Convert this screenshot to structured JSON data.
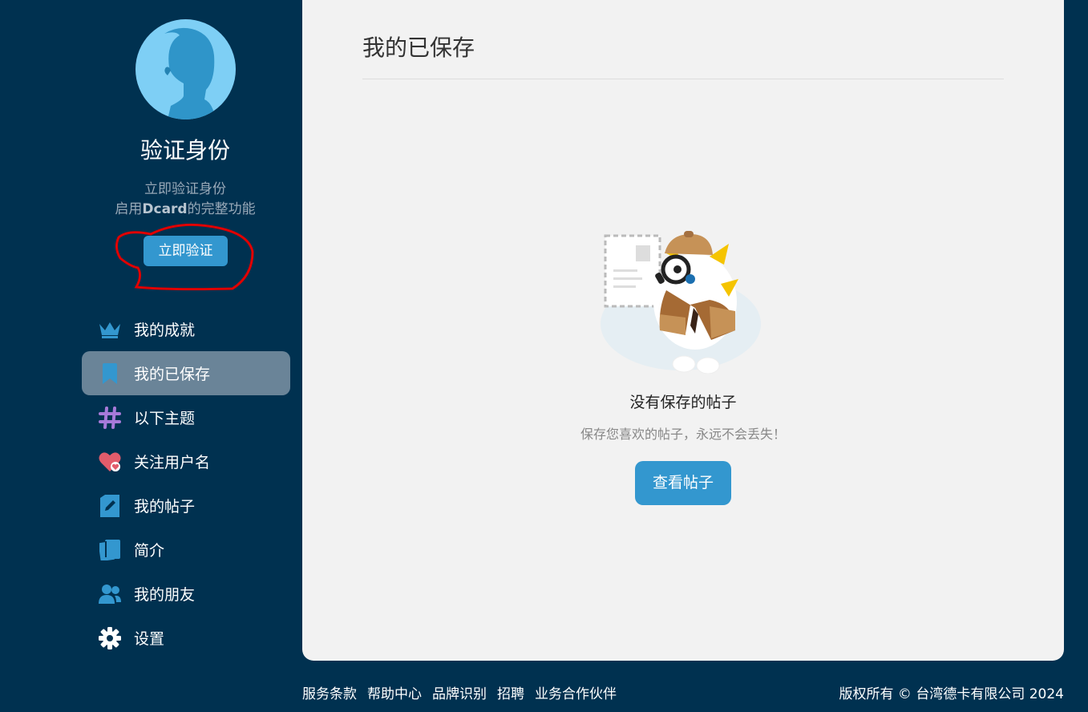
{
  "sidebar": {
    "verify_title": "验证身份",
    "verify_line1": "立即验证身份",
    "verify_line2_prefix": "启用",
    "verify_line2_brand": "Dcard",
    "verify_line2_suffix": "的完整功能",
    "verify_button": "立即验证",
    "items": [
      {
        "label": "我的成就",
        "icon": "crown-icon",
        "color": "#3397cf",
        "active": false
      },
      {
        "label": "我的已保存",
        "icon": "bookmark-icon",
        "color": "#3397cf",
        "active": true
      },
      {
        "label": "以下主题",
        "icon": "hashtag-icon",
        "color": "#a77ad9",
        "active": false
      },
      {
        "label": "关注用户名",
        "icon": "heart-icon",
        "color": "#e25c6b",
        "active": false
      },
      {
        "label": "我的帖子",
        "icon": "edit-post-icon",
        "color": "#3397cf",
        "active": false
      },
      {
        "label": "简介",
        "icon": "profile-card-icon",
        "color": "#3397cf",
        "active": false
      },
      {
        "label": "我的朋友",
        "icon": "friends-icon",
        "color": "#3397cf",
        "active": false
      },
      {
        "label": "设置",
        "icon": "gear-icon",
        "color": "#ffffff",
        "active": false
      }
    ]
  },
  "main": {
    "title": "我的已保存",
    "empty_title": "没有保存的帖子",
    "empty_desc": "保存您喜欢的帖子，永远不会丢失！",
    "view_button": "查看帖子"
  },
  "footer": {
    "links": [
      "服务条款",
      "帮助中心",
      "品牌识别",
      "招聘",
      "业务合作伙伴"
    ],
    "copyright": "版权所有 © 台湾德卡有限公司 2024"
  },
  "colors": {
    "background": "#003150",
    "accent": "#3397cf",
    "panel": "#f2f2f2",
    "active_item": "#6a8498",
    "annotation": "#e00000"
  }
}
